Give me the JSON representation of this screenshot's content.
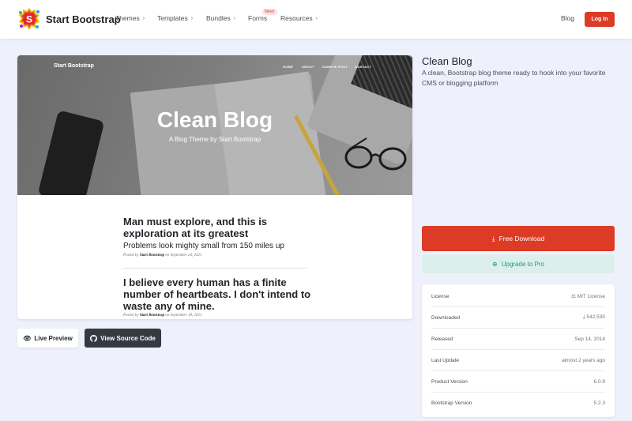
{
  "nav": {
    "brand": "Start Bootstrap",
    "items": [
      {
        "label": "Themes"
      },
      {
        "label": "Templates"
      },
      {
        "label": "Bundles"
      },
      {
        "label": "Forms",
        "badge": "New!"
      },
      {
        "label": "Resources"
      }
    ],
    "blog": "Blog",
    "login": "Log In"
  },
  "preview": {
    "brand": "Start Bootstrap",
    "links": [
      "HOME",
      "ABOUT",
      "SAMPLE POST",
      "CONTACT"
    ],
    "title": "Clean Blog",
    "subtitle": "A Blog Theme by Start Bootstrap",
    "posts": [
      {
        "title": "Man must explore, and this is exploration at its greatest",
        "subtitle": "Problems look mighty small from 150 miles up",
        "meta_prefix": "Posted by",
        "author": "Start Bootstrap",
        "meta_date": "on September 24, 2021"
      },
      {
        "title": "I believe every human has a finite number of heartbeats. I don't intend to waste any of mine.",
        "meta_prefix": "Posted by",
        "author": "Start Bootstrap",
        "meta_date": "on September 18, 2021"
      }
    ]
  },
  "buttons": {
    "live_preview": "Live Preview",
    "view_source": "View Source Code"
  },
  "theme": {
    "title": "Clean Blog",
    "description": "A clean, Bootstrap blog theme ready to hook into your favorite CMS or blogging platform",
    "download": "Free Download",
    "upgrade": "Upgrade to Pro"
  },
  "info": [
    {
      "label": "License",
      "value": "MIT License",
      "icon": "license-icon"
    },
    {
      "label": "Downloaded",
      "value": "542,535",
      "icon": "download-icon"
    },
    {
      "label": "Released",
      "value": "Sep 14, 2014"
    },
    {
      "label": "Last Update",
      "value": "almost 2 years ago"
    },
    {
      "label": "Product Version",
      "value": "6.0.9"
    },
    {
      "label": "Bootstrap Version",
      "value": "5.2.3"
    }
  ],
  "colors": {
    "accent": "#dc3b26",
    "pro_bg": "#dcefea",
    "pro_text": "#1e9b74",
    "page_bg": "#eef1fb"
  }
}
